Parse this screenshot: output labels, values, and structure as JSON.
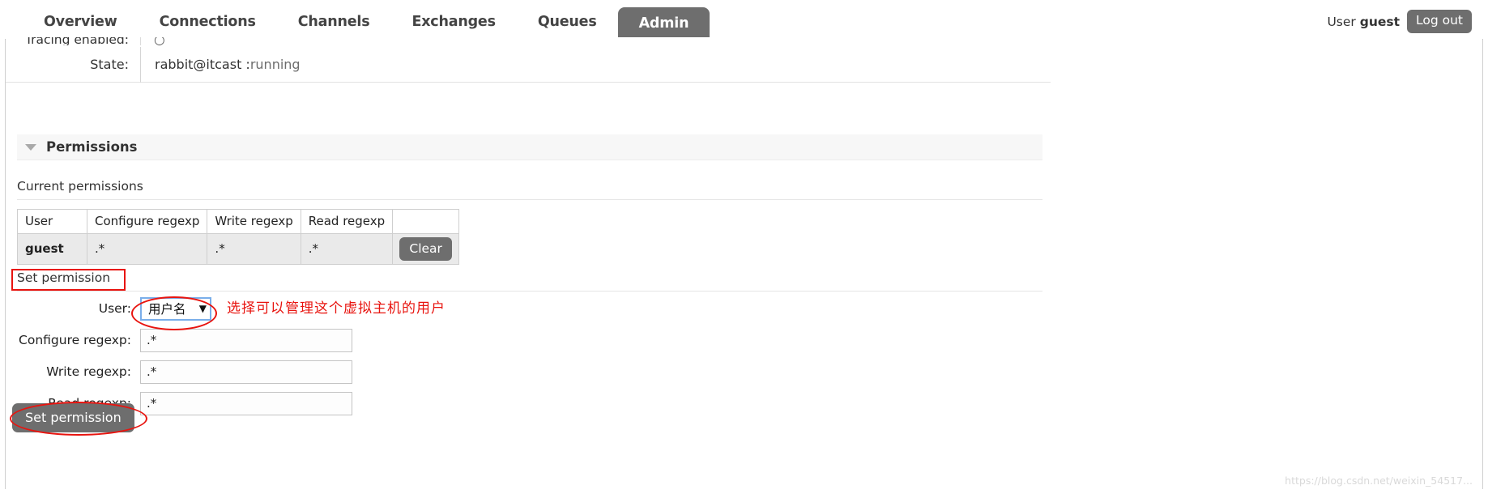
{
  "nav": {
    "tabs": [
      {
        "label": "Overview",
        "active": false
      },
      {
        "label": "Connections",
        "active": false
      },
      {
        "label": "Channels",
        "active": false
      },
      {
        "label": "Exchanges",
        "active": false
      },
      {
        "label": "Queues",
        "active": false
      },
      {
        "label": "Admin",
        "active": true
      }
    ],
    "user_prefix": "User",
    "user_name": "guest",
    "logout_label": "Log out"
  },
  "overview": {
    "tracing_label": "Tracing enabled:",
    "tracing_value": "○",
    "state_label": "State:",
    "state_value": "rabbit@itcast : ",
    "state_status": "running"
  },
  "permissions_section": {
    "title": "Permissions",
    "caption": "Current permissions",
    "table": {
      "columns": [
        "User",
        "Configure regexp",
        "Write regexp",
        "Read regexp",
        ""
      ],
      "rows": [
        {
          "user": "guest",
          "configure": ".*",
          "write": ".*",
          "read": ".*",
          "action_label": "Clear"
        }
      ]
    }
  },
  "set_permission": {
    "heading": "Set permission",
    "fields": {
      "user_label": "User:",
      "user_value": "用户名",
      "configure_label": "Configure regexp:",
      "configure_value": ".*",
      "write_label": "Write regexp:",
      "write_value": ".*",
      "read_label": "Read regexp:",
      "read_value": ".*"
    },
    "submit_label": "Set permission"
  },
  "annotations": {
    "note_cn": "选择可以管理这个虚拟主机的用户",
    "watermark": "https://blog.csdn.net/weixin_54517..."
  },
  "icons": {
    "caret_down": "▼",
    "collapse_triangle": "▼"
  },
  "colors": {
    "accent_gray": "#6e6e6e",
    "annotation_red": "#e8140f",
    "focus_blue": "#7aaeea"
  }
}
